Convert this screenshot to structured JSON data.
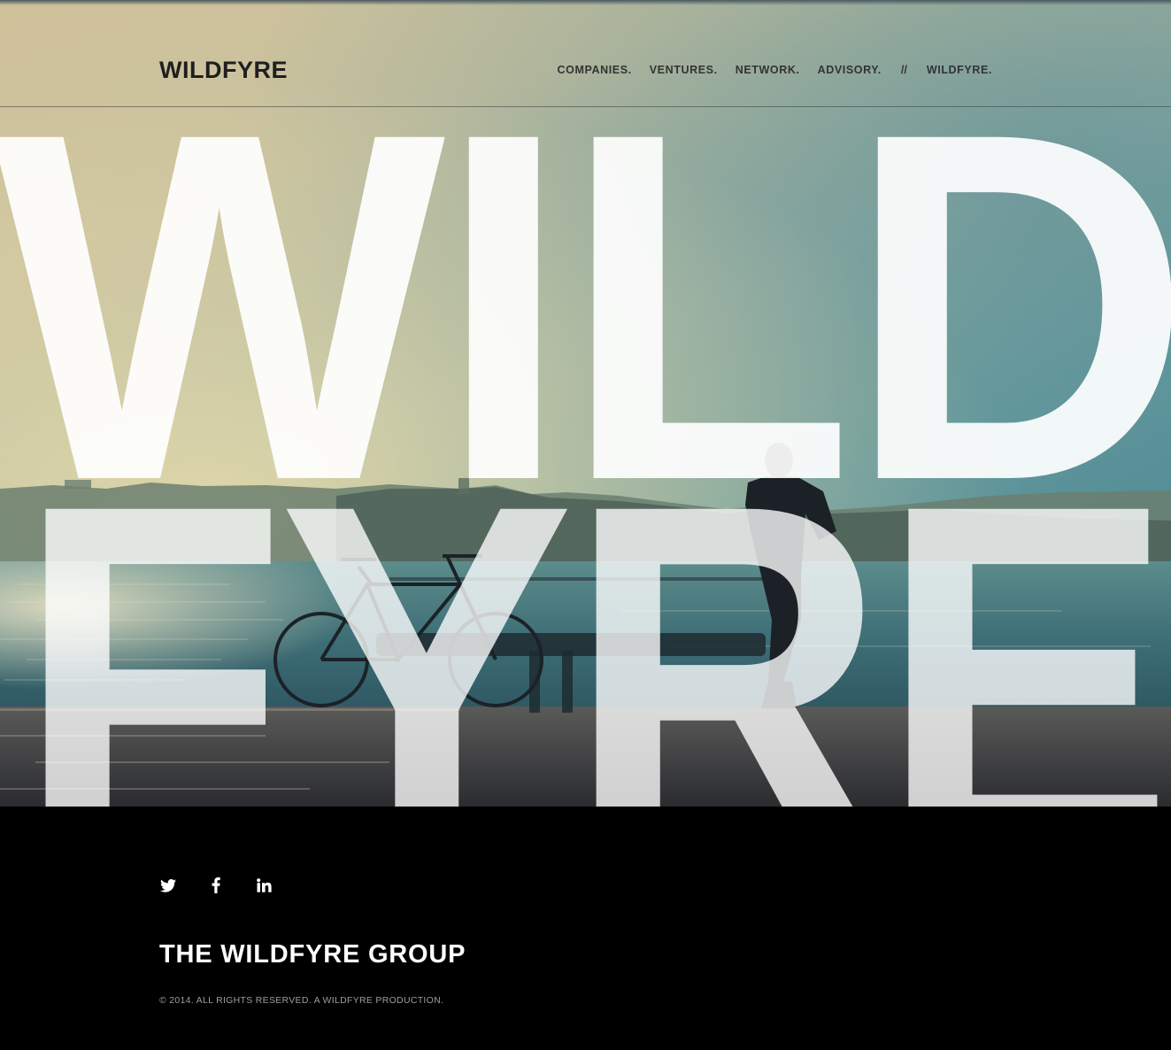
{
  "header": {
    "logo": "WILDFYRE",
    "nav": [
      {
        "label": "COMPANIES."
      },
      {
        "label": "VENTURES."
      },
      {
        "label": "NETWORK."
      },
      {
        "label": "ADVISORY."
      }
    ],
    "separator": "//",
    "nav_end": "WILDFYRE."
  },
  "hero": {
    "line1": "WILD",
    "line2": "FYRE"
  },
  "footer": {
    "social": [
      {
        "name": "twitter-icon"
      },
      {
        "name": "facebook-icon"
      },
      {
        "name": "linkedin-icon"
      }
    ],
    "title": "THE WILDFYRE GROUP",
    "copyright": "© 2014. ALL RIGHTS RESERVED. A WILDFYRE PRODUCTION."
  },
  "colors": {
    "footer_bg": "#000000",
    "text_dark": "#1f1f1f",
    "text_white": "#ffffff",
    "copyright_gray": "#9c9c9c"
  }
}
